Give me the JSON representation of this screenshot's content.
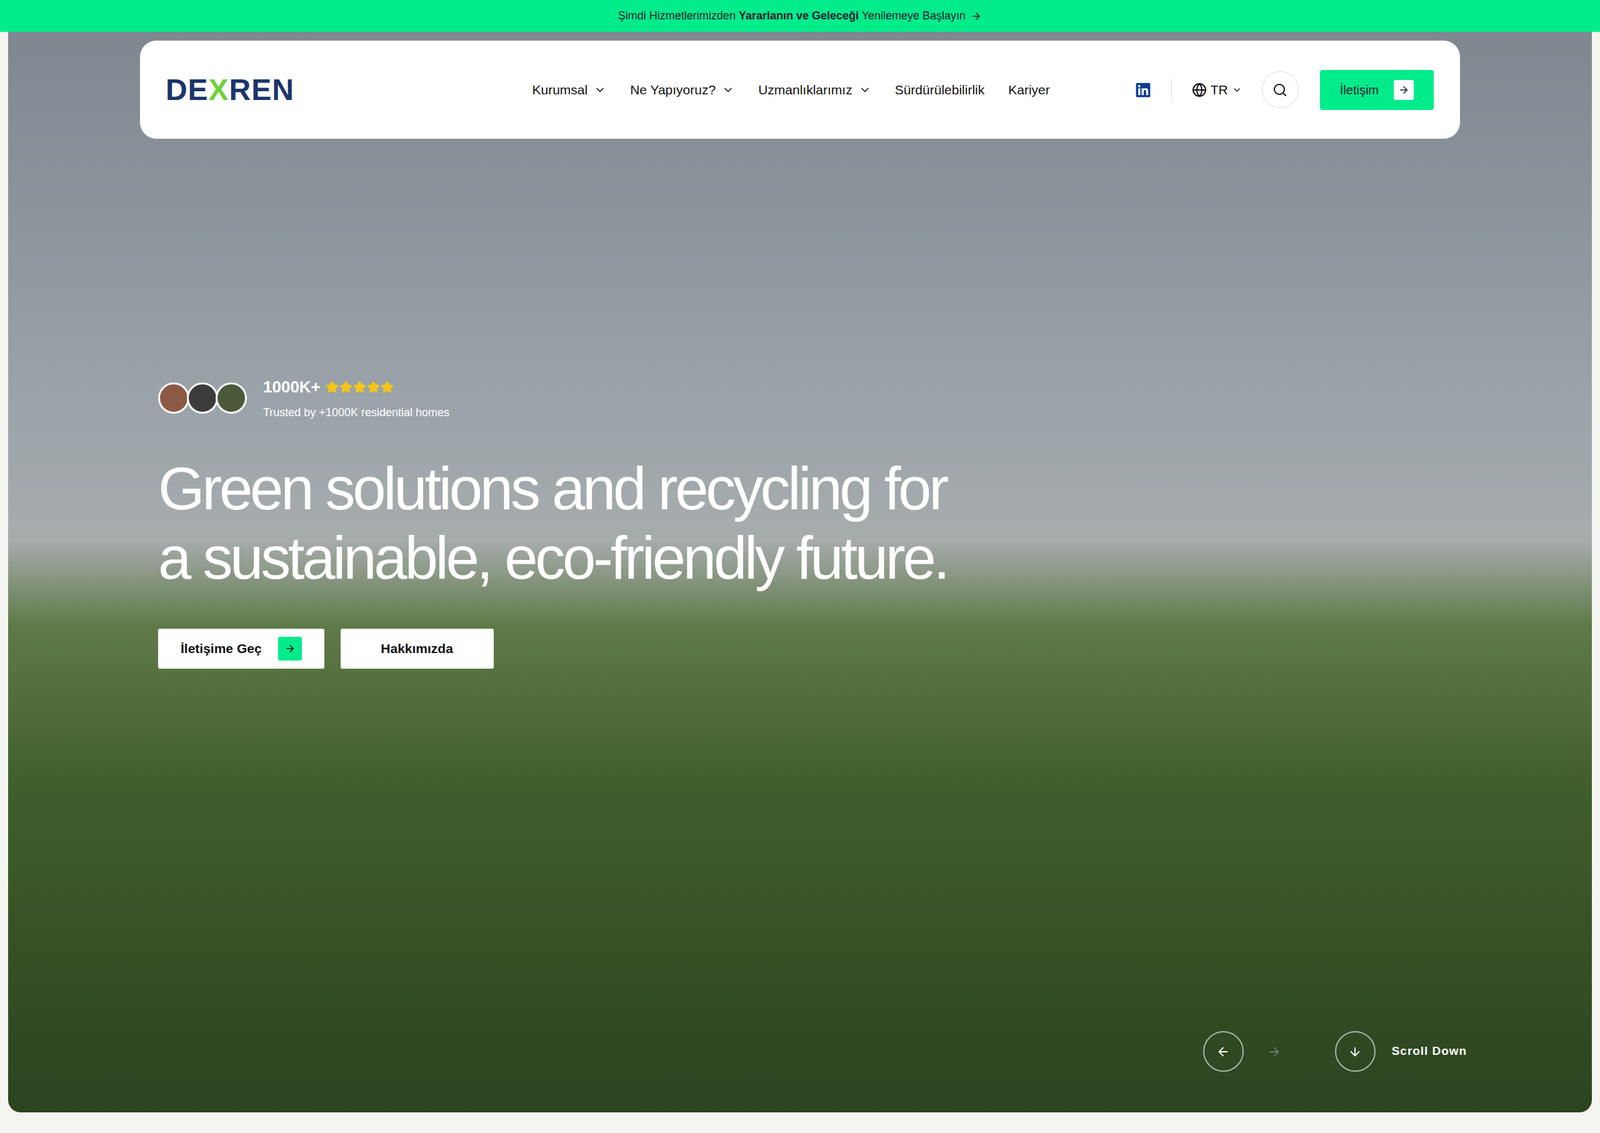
{
  "announcement": {
    "prefix": "Şimdi Hizmetlerimizden ",
    "highlight": "Yararlanın ve Geleceği",
    "suffix": " Yenilemeye Başlayın"
  },
  "logo": {
    "before": "DE",
    "accent": "X",
    "after": "REN"
  },
  "nav": {
    "items": [
      {
        "label": "Kurumsal",
        "has_menu": true
      },
      {
        "label": "Ne Yapıyoruz?",
        "has_menu": true
      },
      {
        "label": "Uzmanlıklarımız",
        "has_menu": true
      },
      {
        "label": "Sürdürülebilirlik",
        "has_menu": false
      },
      {
        "label": "Kariyer",
        "has_menu": false
      }
    ],
    "language": "TR",
    "cta": "İletişim"
  },
  "hero": {
    "rating": {
      "count": "1000K+",
      "stars": 5,
      "caption": "Trusted by +1000K residential homes"
    },
    "heading": [
      "Green solutions and recycling for",
      "a sustainable, eco-friendly future."
    ],
    "buttons": [
      {
        "label": "İletişime Geç",
        "kind": "arrow"
      },
      {
        "label": "Hakkımızda",
        "kind": "plain"
      }
    ]
  },
  "carousel": {
    "prev_disabled": false,
    "next_disabled": true
  },
  "scroll": "Scroll Down"
}
